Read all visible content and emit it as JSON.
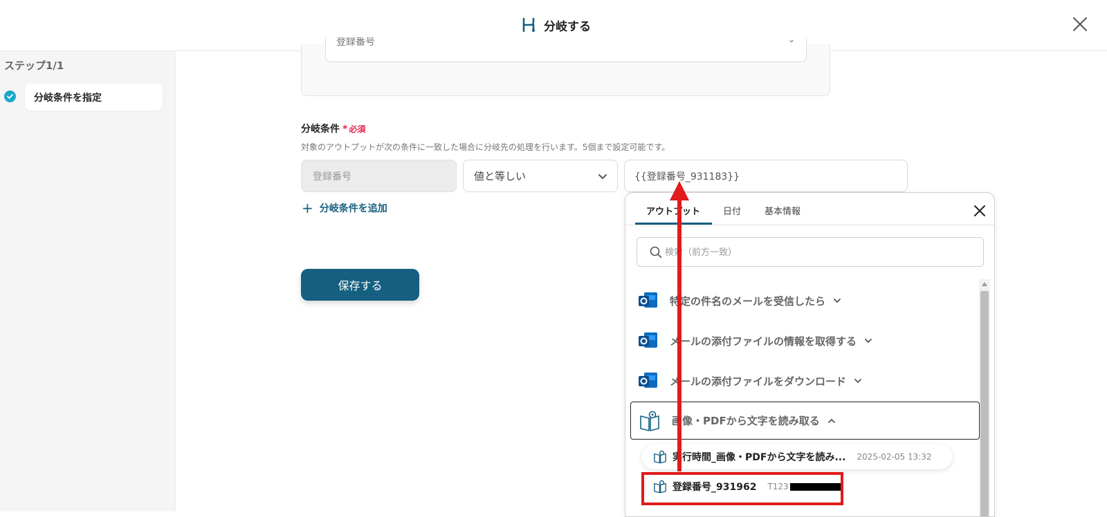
{
  "header": {
    "title": "分岐する",
    "accent": "#155f80"
  },
  "sidebar": {
    "step_count": "ステップ1/1",
    "steps": [
      {
        "label": "分岐条件を指定",
        "status": "done"
      }
    ]
  },
  "form": {
    "prev_select_value": "登録番号",
    "condition_label": "分岐条件",
    "required_star": "*",
    "required_text": "必須",
    "description": "対象のアウトプットが次の条件に一致した場合に分岐先の処理を行います。5個まで設定可能です。",
    "field_target": "登録番号",
    "operator": "値と等しい",
    "value": "{{登録番号_931183}}",
    "add_condition": "分岐条件を追加",
    "save": "保存する"
  },
  "picker": {
    "tabs": [
      {
        "label": "アウトプット",
        "active": true
      },
      {
        "label": "日付",
        "active": false
      },
      {
        "label": "基本情報",
        "active": false
      }
    ],
    "search_placeholder": "検索（前方一致）",
    "sources": [
      {
        "label": "特定の件名のメールを受信したら",
        "icon": "outlook-icon",
        "expanded": false
      },
      {
        "label": "メールの添付ファイルの情報を取得する",
        "icon": "outlook-icon",
        "expanded": false
      },
      {
        "label": "メールの添付ファイルをダウンロード",
        "icon": "outlook-icon",
        "expanded": false
      },
      {
        "label": "画像・PDFから文字を読み取る",
        "icon": "ocr-book-icon",
        "expanded": true
      }
    ],
    "outputs": [
      {
        "name": "実行時間_画像・PDFから文字を読み...",
        "value": "2025-02-05 13:32"
      },
      {
        "name": "登録番号_931962",
        "value": "T123"
      }
    ]
  },
  "colors": {
    "accent": "#155f80",
    "required": "#e5274a",
    "annotation": "#e01b1b",
    "check": "#1aa6c9"
  }
}
